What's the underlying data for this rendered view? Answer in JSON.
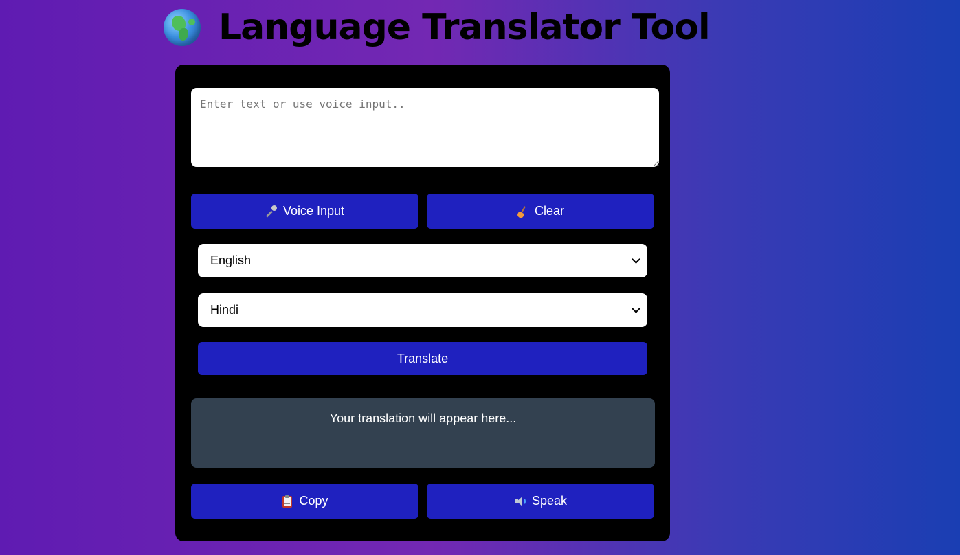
{
  "header": {
    "icon": "globe-icon",
    "title": "Language Translator Tool"
  },
  "input": {
    "placeholder": "Enter text or use voice input..",
    "value": ""
  },
  "actions": {
    "voice_label": "Voice Input",
    "voice_icon": "microphone-icon",
    "clear_label": "Clear",
    "clear_icon": "broom-icon"
  },
  "languages": {
    "from_selected": "English",
    "to_selected": "Hindi"
  },
  "translate": {
    "label": "Translate"
  },
  "output": {
    "placeholder_text": "Your translation will appear here..."
  },
  "output_actions": {
    "copy_label": "Copy",
    "copy_icon": "clipboard-icon",
    "speak_label": "Speak",
    "speak_icon": "speaker-icon"
  },
  "colors": {
    "button_bg": "#1f21bf",
    "card_bg": "#000000",
    "output_bg": "#334150",
    "gradient_start": "#5f1bb2",
    "gradient_end": "#1a3eb3"
  }
}
